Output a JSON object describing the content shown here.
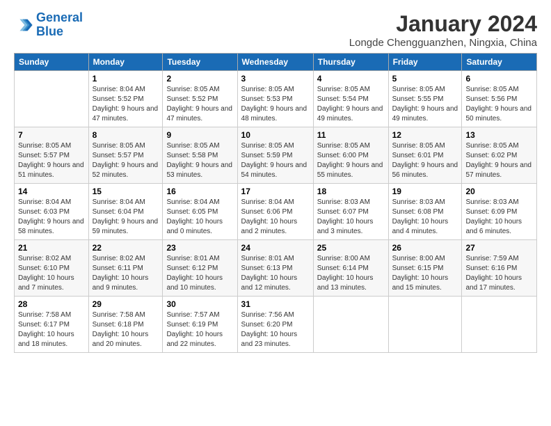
{
  "logo": {
    "line1": "General",
    "line2": "Blue"
  },
  "title": "January 2024",
  "subtitle": "Longde Chengguanzhen, Ningxia, China",
  "days_header": [
    "Sunday",
    "Monday",
    "Tuesday",
    "Wednesday",
    "Thursday",
    "Friday",
    "Saturday"
  ],
  "weeks": [
    [
      {
        "day": "",
        "sunrise": "",
        "sunset": "",
        "daylight": ""
      },
      {
        "day": "1",
        "sunrise": "Sunrise: 8:04 AM",
        "sunset": "Sunset: 5:52 PM",
        "daylight": "Daylight: 9 hours and 47 minutes."
      },
      {
        "day": "2",
        "sunrise": "Sunrise: 8:05 AM",
        "sunset": "Sunset: 5:52 PM",
        "daylight": "Daylight: 9 hours and 47 minutes."
      },
      {
        "day": "3",
        "sunrise": "Sunrise: 8:05 AM",
        "sunset": "Sunset: 5:53 PM",
        "daylight": "Daylight: 9 hours and 48 minutes."
      },
      {
        "day": "4",
        "sunrise": "Sunrise: 8:05 AM",
        "sunset": "Sunset: 5:54 PM",
        "daylight": "Daylight: 9 hours and 49 minutes."
      },
      {
        "day": "5",
        "sunrise": "Sunrise: 8:05 AM",
        "sunset": "Sunset: 5:55 PM",
        "daylight": "Daylight: 9 hours and 49 minutes."
      },
      {
        "day": "6",
        "sunrise": "Sunrise: 8:05 AM",
        "sunset": "Sunset: 5:56 PM",
        "daylight": "Daylight: 9 hours and 50 minutes."
      }
    ],
    [
      {
        "day": "7",
        "sunrise": "Sunrise: 8:05 AM",
        "sunset": "Sunset: 5:57 PM",
        "daylight": "Daylight: 9 hours and 51 minutes."
      },
      {
        "day": "8",
        "sunrise": "Sunrise: 8:05 AM",
        "sunset": "Sunset: 5:57 PM",
        "daylight": "Daylight: 9 hours and 52 minutes."
      },
      {
        "day": "9",
        "sunrise": "Sunrise: 8:05 AM",
        "sunset": "Sunset: 5:58 PM",
        "daylight": "Daylight: 9 hours and 53 minutes."
      },
      {
        "day": "10",
        "sunrise": "Sunrise: 8:05 AM",
        "sunset": "Sunset: 5:59 PM",
        "daylight": "Daylight: 9 hours and 54 minutes."
      },
      {
        "day": "11",
        "sunrise": "Sunrise: 8:05 AM",
        "sunset": "Sunset: 6:00 PM",
        "daylight": "Daylight: 9 hours and 55 minutes."
      },
      {
        "day": "12",
        "sunrise": "Sunrise: 8:05 AM",
        "sunset": "Sunset: 6:01 PM",
        "daylight": "Daylight: 9 hours and 56 minutes."
      },
      {
        "day": "13",
        "sunrise": "Sunrise: 8:05 AM",
        "sunset": "Sunset: 6:02 PM",
        "daylight": "Daylight: 9 hours and 57 minutes."
      }
    ],
    [
      {
        "day": "14",
        "sunrise": "Sunrise: 8:04 AM",
        "sunset": "Sunset: 6:03 PM",
        "daylight": "Daylight: 9 hours and 58 minutes."
      },
      {
        "day": "15",
        "sunrise": "Sunrise: 8:04 AM",
        "sunset": "Sunset: 6:04 PM",
        "daylight": "Daylight: 9 hours and 59 minutes."
      },
      {
        "day": "16",
        "sunrise": "Sunrise: 8:04 AM",
        "sunset": "Sunset: 6:05 PM",
        "daylight": "Daylight: 10 hours and 0 minutes."
      },
      {
        "day": "17",
        "sunrise": "Sunrise: 8:04 AM",
        "sunset": "Sunset: 6:06 PM",
        "daylight": "Daylight: 10 hours and 2 minutes."
      },
      {
        "day": "18",
        "sunrise": "Sunrise: 8:03 AM",
        "sunset": "Sunset: 6:07 PM",
        "daylight": "Daylight: 10 hours and 3 minutes."
      },
      {
        "day": "19",
        "sunrise": "Sunrise: 8:03 AM",
        "sunset": "Sunset: 6:08 PM",
        "daylight": "Daylight: 10 hours and 4 minutes."
      },
      {
        "day": "20",
        "sunrise": "Sunrise: 8:03 AM",
        "sunset": "Sunset: 6:09 PM",
        "daylight": "Daylight: 10 hours and 6 minutes."
      }
    ],
    [
      {
        "day": "21",
        "sunrise": "Sunrise: 8:02 AM",
        "sunset": "Sunset: 6:10 PM",
        "daylight": "Daylight: 10 hours and 7 minutes."
      },
      {
        "day": "22",
        "sunrise": "Sunrise: 8:02 AM",
        "sunset": "Sunset: 6:11 PM",
        "daylight": "Daylight: 10 hours and 9 minutes."
      },
      {
        "day": "23",
        "sunrise": "Sunrise: 8:01 AM",
        "sunset": "Sunset: 6:12 PM",
        "daylight": "Daylight: 10 hours and 10 minutes."
      },
      {
        "day": "24",
        "sunrise": "Sunrise: 8:01 AM",
        "sunset": "Sunset: 6:13 PM",
        "daylight": "Daylight: 10 hours and 12 minutes."
      },
      {
        "day": "25",
        "sunrise": "Sunrise: 8:00 AM",
        "sunset": "Sunset: 6:14 PM",
        "daylight": "Daylight: 10 hours and 13 minutes."
      },
      {
        "day": "26",
        "sunrise": "Sunrise: 8:00 AM",
        "sunset": "Sunset: 6:15 PM",
        "daylight": "Daylight: 10 hours and 15 minutes."
      },
      {
        "day": "27",
        "sunrise": "Sunrise: 7:59 AM",
        "sunset": "Sunset: 6:16 PM",
        "daylight": "Daylight: 10 hours and 17 minutes."
      }
    ],
    [
      {
        "day": "28",
        "sunrise": "Sunrise: 7:58 AM",
        "sunset": "Sunset: 6:17 PM",
        "daylight": "Daylight: 10 hours and 18 minutes."
      },
      {
        "day": "29",
        "sunrise": "Sunrise: 7:58 AM",
        "sunset": "Sunset: 6:18 PM",
        "daylight": "Daylight: 10 hours and 20 minutes."
      },
      {
        "day": "30",
        "sunrise": "Sunrise: 7:57 AM",
        "sunset": "Sunset: 6:19 PM",
        "daylight": "Daylight: 10 hours and 22 minutes."
      },
      {
        "day": "31",
        "sunrise": "Sunrise: 7:56 AM",
        "sunset": "Sunset: 6:20 PM",
        "daylight": "Daylight: 10 hours and 23 minutes."
      },
      {
        "day": "",
        "sunrise": "",
        "sunset": "",
        "daylight": ""
      },
      {
        "day": "",
        "sunrise": "",
        "sunset": "",
        "daylight": ""
      },
      {
        "day": "",
        "sunrise": "",
        "sunset": "",
        "daylight": ""
      }
    ]
  ]
}
